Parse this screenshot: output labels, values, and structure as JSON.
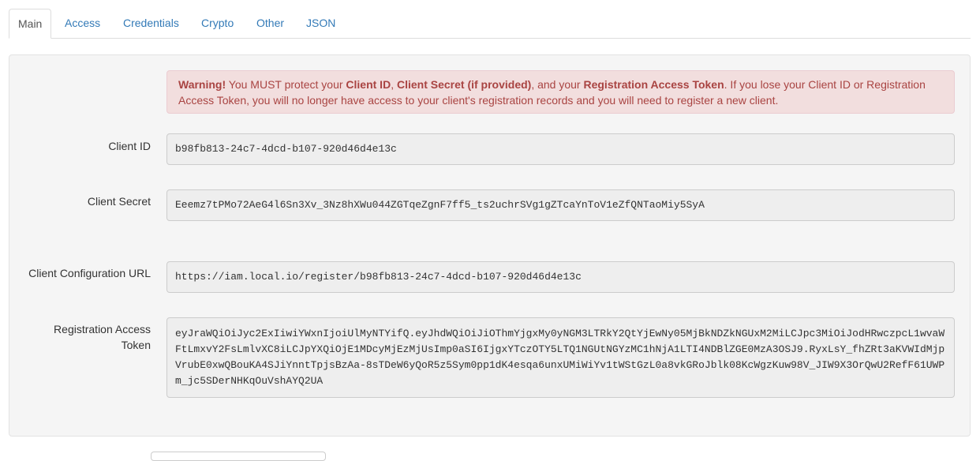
{
  "tabs": [
    {
      "label": "Main",
      "active": true
    },
    {
      "label": "Access",
      "active": false
    },
    {
      "label": "Credentials",
      "active": false
    },
    {
      "label": "Crypto",
      "active": false
    },
    {
      "label": "Other",
      "active": false
    },
    {
      "label": "JSON",
      "active": false
    }
  ],
  "warning": {
    "prefix": "Warning!",
    "t1": " You MUST protect your ",
    "client_id": "Client ID",
    "t2": ", ",
    "client_secret": "Client Secret (if provided)",
    "t3": ", and your ",
    "rat": "Registration Access Token",
    "t4": ". If you lose your Client ID or Registration Access Token, you will no longer have access to your client's registration records and you will need to register a new client."
  },
  "fields": {
    "client_id": {
      "label": "Client ID",
      "value": "b98fb813-24c7-4dcd-b107-920d46d4e13c"
    },
    "client_secret": {
      "label": "Client Secret",
      "value": "Eeemz7tPMo72AeG4l6Sn3Xv_3Nz8hXWu044ZGTqeZgnF7ff5_ts2uchrSVg1gZTcaYnToV1eZfQNTaoMiy5SyA"
    },
    "config_url": {
      "label": "Client Configuration URL",
      "value": "https://iam.local.io/register/b98fb813-24c7-4dcd-b107-920d46d4e13c"
    },
    "reg_token": {
      "label_line1": "Registration Access",
      "label_line2": "Token",
      "value": "eyJraWQiOiJyc2ExIiwiYWxnIjoiUlMyNTYifQ.eyJhdWQiOiJiOThmYjgxMy0yNGM3LTRkY2QtYjEwNy05MjBkNDZkNGUxM2MiLCJpc3MiOiJodHRwczpcL1wvaWFtLmxvY2FsLmlvXC8iLCJpYXQiOjE1MDcyMjEzMjUsImp0aSI6IjgxYTczOTY5LTQ1NGUtNGYzMC1hNjA1LTI4NDBlZGE0MzA3OSJ9.RyxLsY_fhZRt3aKVWIdMjpVrubE0xwQBouKA4SJiYnntTpjsBzAa-8sTDeW6yQoR5z5Sym0pp1dK4esqa6unxUMiWiYv1tWStGzL0a8vkGRoJblk08KcWgzKuw98V_JIW9X3OrQwU2RefF61UWPm_jc5SDerNHKqOuVshAYQ2UA"
    }
  }
}
